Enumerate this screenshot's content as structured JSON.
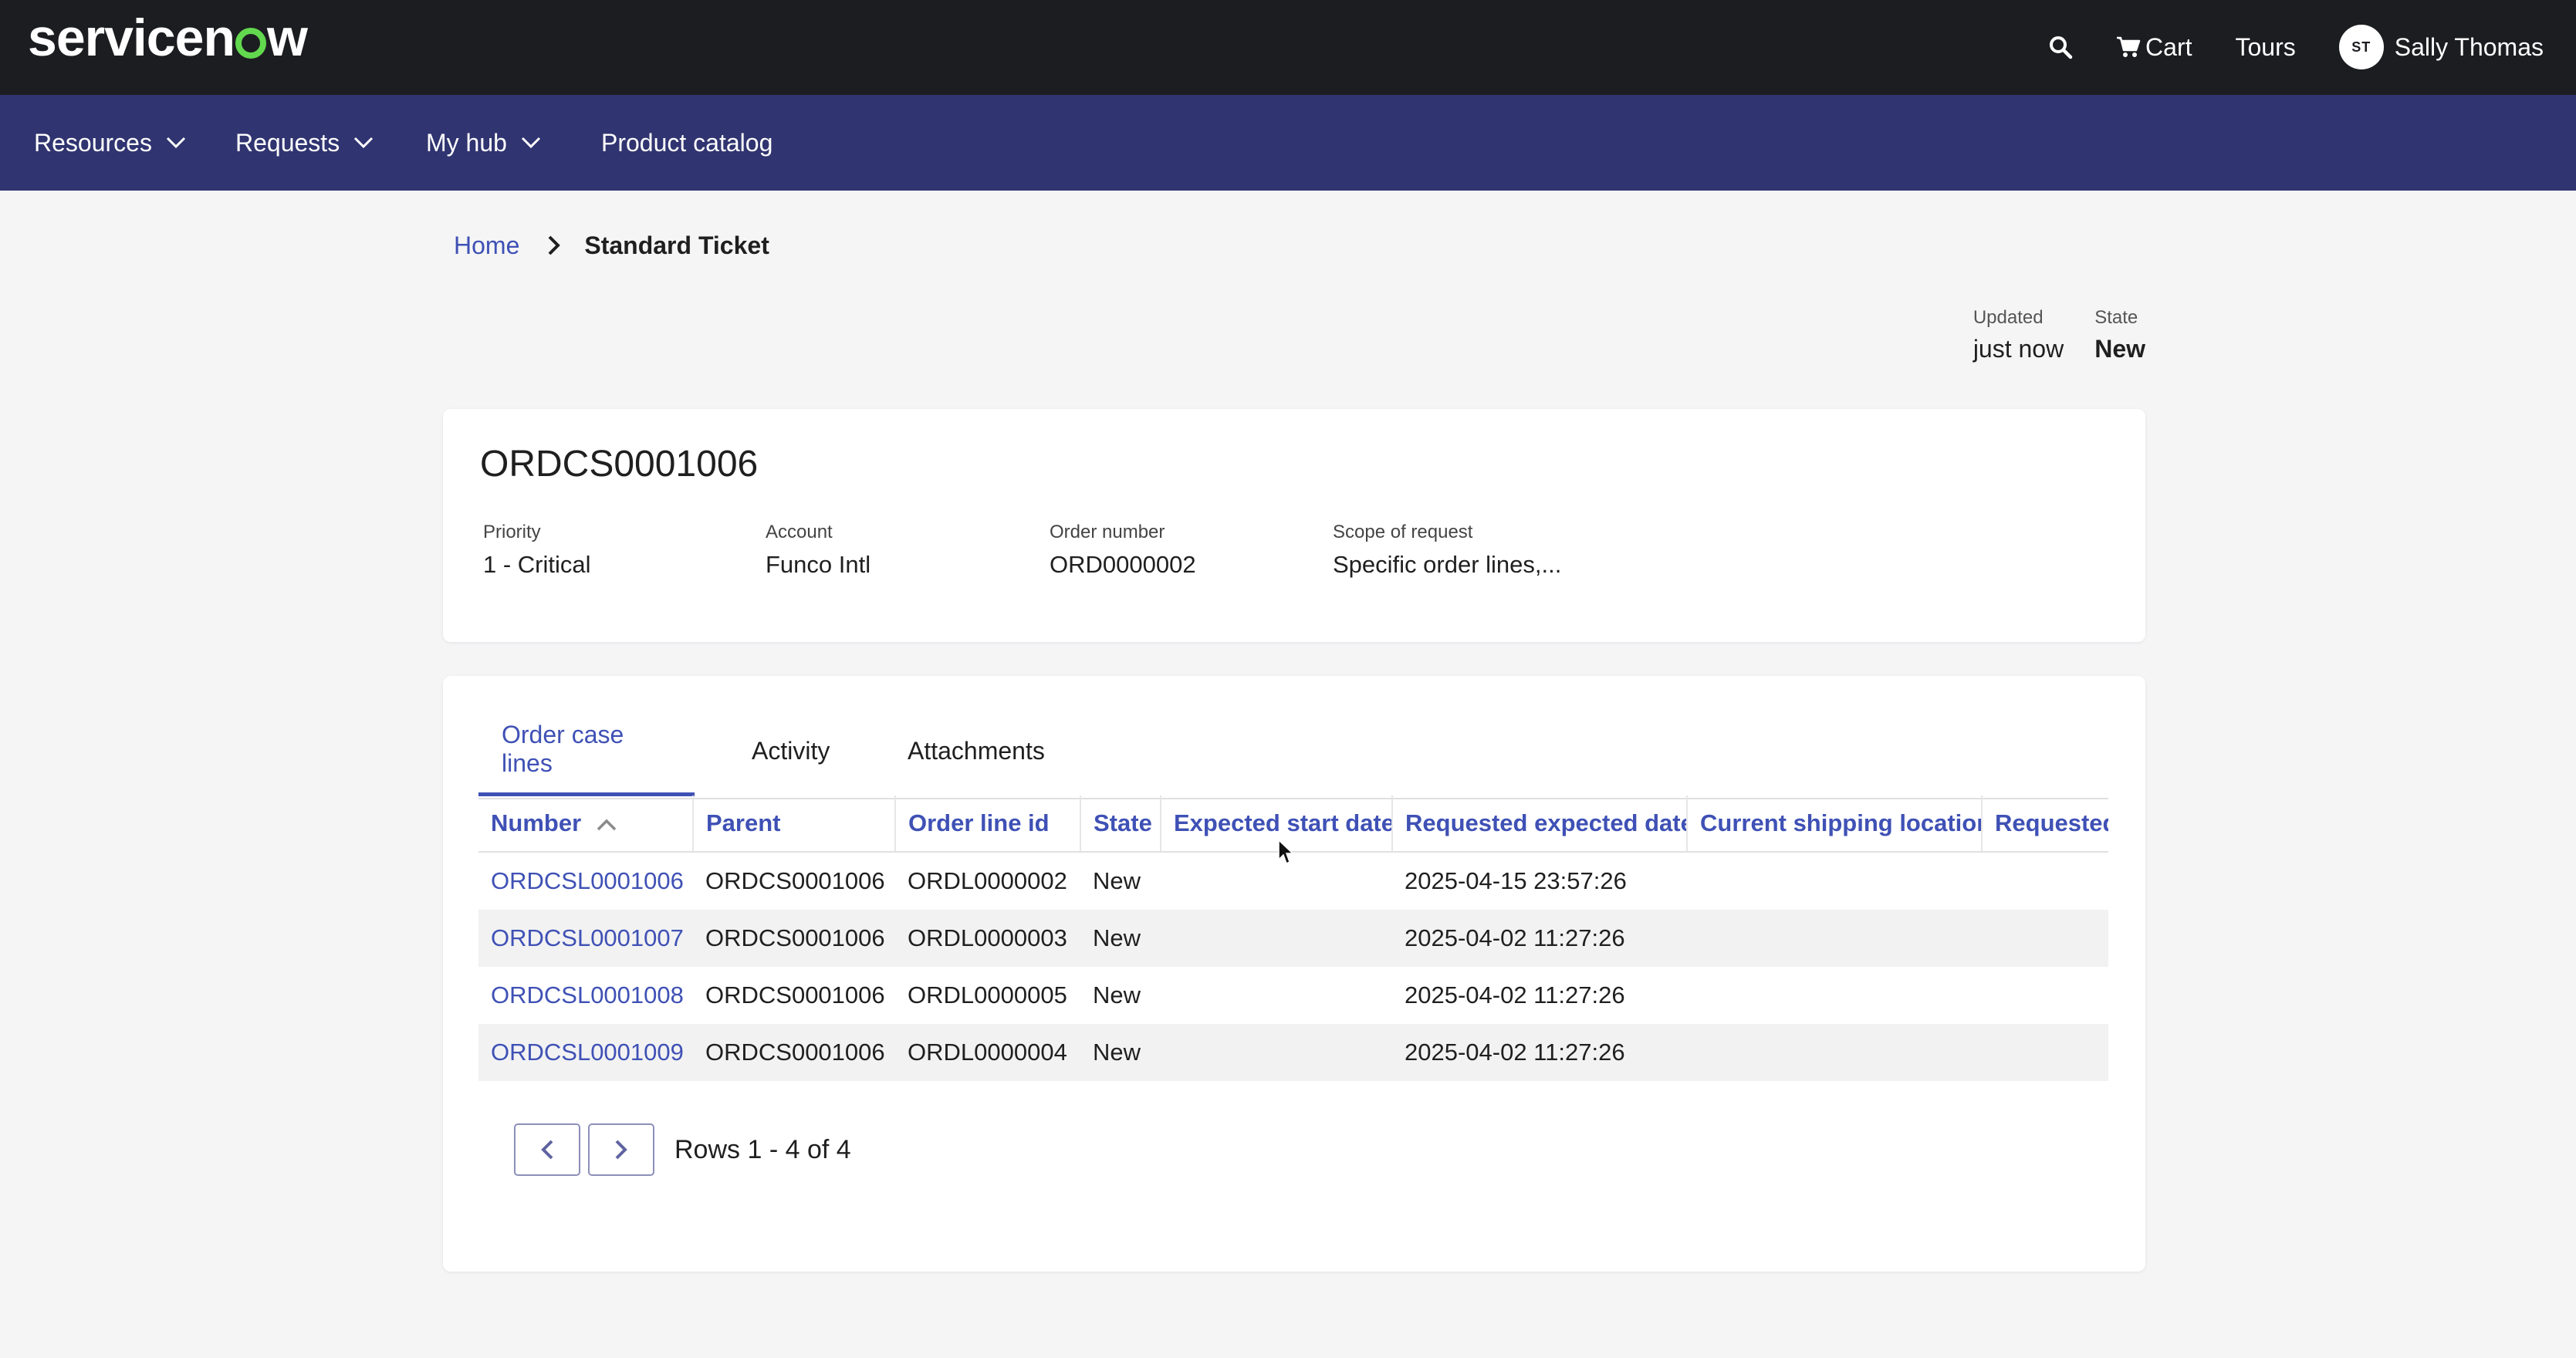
{
  "header": {
    "brand": "servicenow",
    "cart_label": "Cart",
    "tours_label": "Tours",
    "user_initials": "ST",
    "user_name": "Sally Thomas"
  },
  "nav": {
    "items": [
      {
        "label": "Resources"
      },
      {
        "label": "Requests"
      },
      {
        "label": "My hub"
      },
      {
        "label": "Product catalog"
      }
    ]
  },
  "breadcrumb": {
    "home": "Home",
    "current": "Standard Ticket"
  },
  "meta": {
    "updated_label": "Updated",
    "updated_value": "just now",
    "state_label": "State",
    "state_value": "New"
  },
  "case": {
    "number": "ORDCS0001006",
    "fields": [
      {
        "label": "Priority",
        "value": "1 - Critical"
      },
      {
        "label": "Account",
        "value": "Funco Intl"
      },
      {
        "label": "Order number",
        "value": "ORD0000002"
      },
      {
        "label": "Scope of request",
        "value": "Specific order lines,..."
      }
    ]
  },
  "tabs": [
    {
      "label": "Order case lines"
    },
    {
      "label": "Activity"
    },
    {
      "label": "Attachments"
    }
  ],
  "table": {
    "columns": [
      "Number",
      "Parent",
      "Order line id",
      "State",
      "Expected start date",
      "Requested expected date",
      "Current shipping location",
      "Requested"
    ],
    "rows": [
      [
        "ORDCSL0001006",
        "ORDCS0001006",
        "ORDL0000002",
        "New",
        "",
        "2025-04-15 23:57:26",
        "",
        ""
      ],
      [
        "ORDCSL0001007",
        "ORDCS0001006",
        "ORDL0000003",
        "New",
        "",
        "2025-04-02 11:27:26",
        "",
        ""
      ],
      [
        "ORDCSL0001008",
        "ORDCS0001006",
        "ORDL0000005",
        "New",
        "",
        "2025-04-02 11:27:26",
        "",
        ""
      ],
      [
        "ORDCSL0001009",
        "ORDCS0001006",
        "ORDL0000004",
        "New",
        "",
        "2025-04-02 11:27:26",
        "",
        ""
      ]
    ]
  },
  "pagination": {
    "rows_label": "Rows 1 - 4 of 4"
  },
  "colors": {
    "topbar": "#1c1d21",
    "navbar": "#303470",
    "accent": "#3f51b5",
    "logo_ring": "#62d84e"
  },
  "icons": {
    "search": "search-icon",
    "cart": "cart-icon",
    "chevron": "chevron-down-icon",
    "breadcrumb_sep": "chevron-right-icon",
    "sort": "sort-ascending-icon",
    "prev": "chevron-left-icon",
    "next": "chevron-right-icon"
  }
}
